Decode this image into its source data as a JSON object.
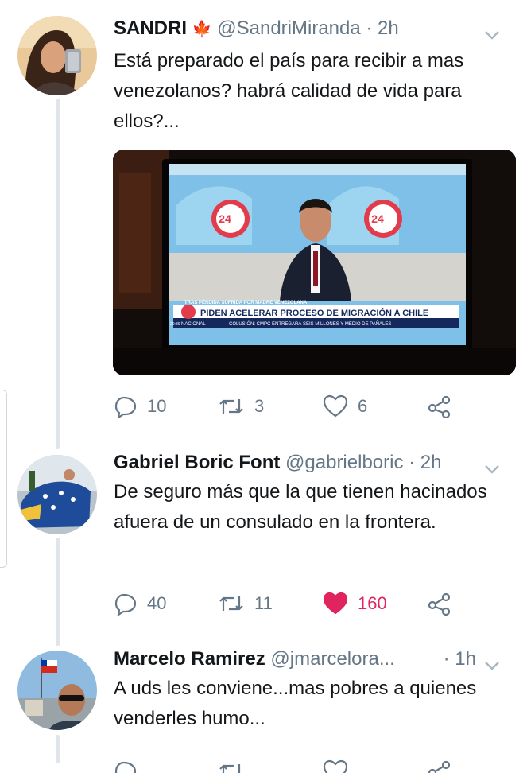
{
  "tweets": [
    {
      "name": "SANDRI",
      "emoji": "🍁",
      "handle": "@SandriMiranda",
      "time": "· 2h",
      "text": "Está preparado el país para recibir a mas venezolanos? habrá calidad de vida para ellos?...",
      "media": {
        "channel_badge": "24",
        "kicker": "TRAS PÉRDIDA SUFRIDA POR MADRE VENEZOLANA",
        "headline": "PIDEN ACELERAR PROCESO DE MIGRACIÓN A CHILE",
        "ticker_tag": "NACIONAL",
        "ticker_time": "20:39",
        "ticker_text": "COLUSIÓN: CMPC ENTREGARÁ SEIS MILLONES Y MEDIO DE PAÑALES"
      },
      "replies": "10",
      "retweets": "3",
      "likes": "6"
    },
    {
      "name": "Gabriel Boric Font",
      "handle": "@gabrielboric",
      "time": "· 2h",
      "text": "De seguro más que la que tienen hacinados afuera de un consulado en la frontera.",
      "replies": "40",
      "retweets": "11",
      "likes": "160",
      "liked": true
    },
    {
      "name": "Marcelo Ramirez",
      "handle": "@jmarcelora...",
      "time": "· 1h",
      "text": "A uds les conviene...mas pobres a quienes venderles humo..."
    }
  ],
  "colors": {
    "text_primary": "#14171a",
    "text_secondary": "#657786",
    "like_active": "#e0245e",
    "thread_line": "#dfe5ea"
  },
  "icons": [
    "reply-icon",
    "retweet-icon",
    "like-icon",
    "share-icon",
    "chevron-down-icon"
  ]
}
